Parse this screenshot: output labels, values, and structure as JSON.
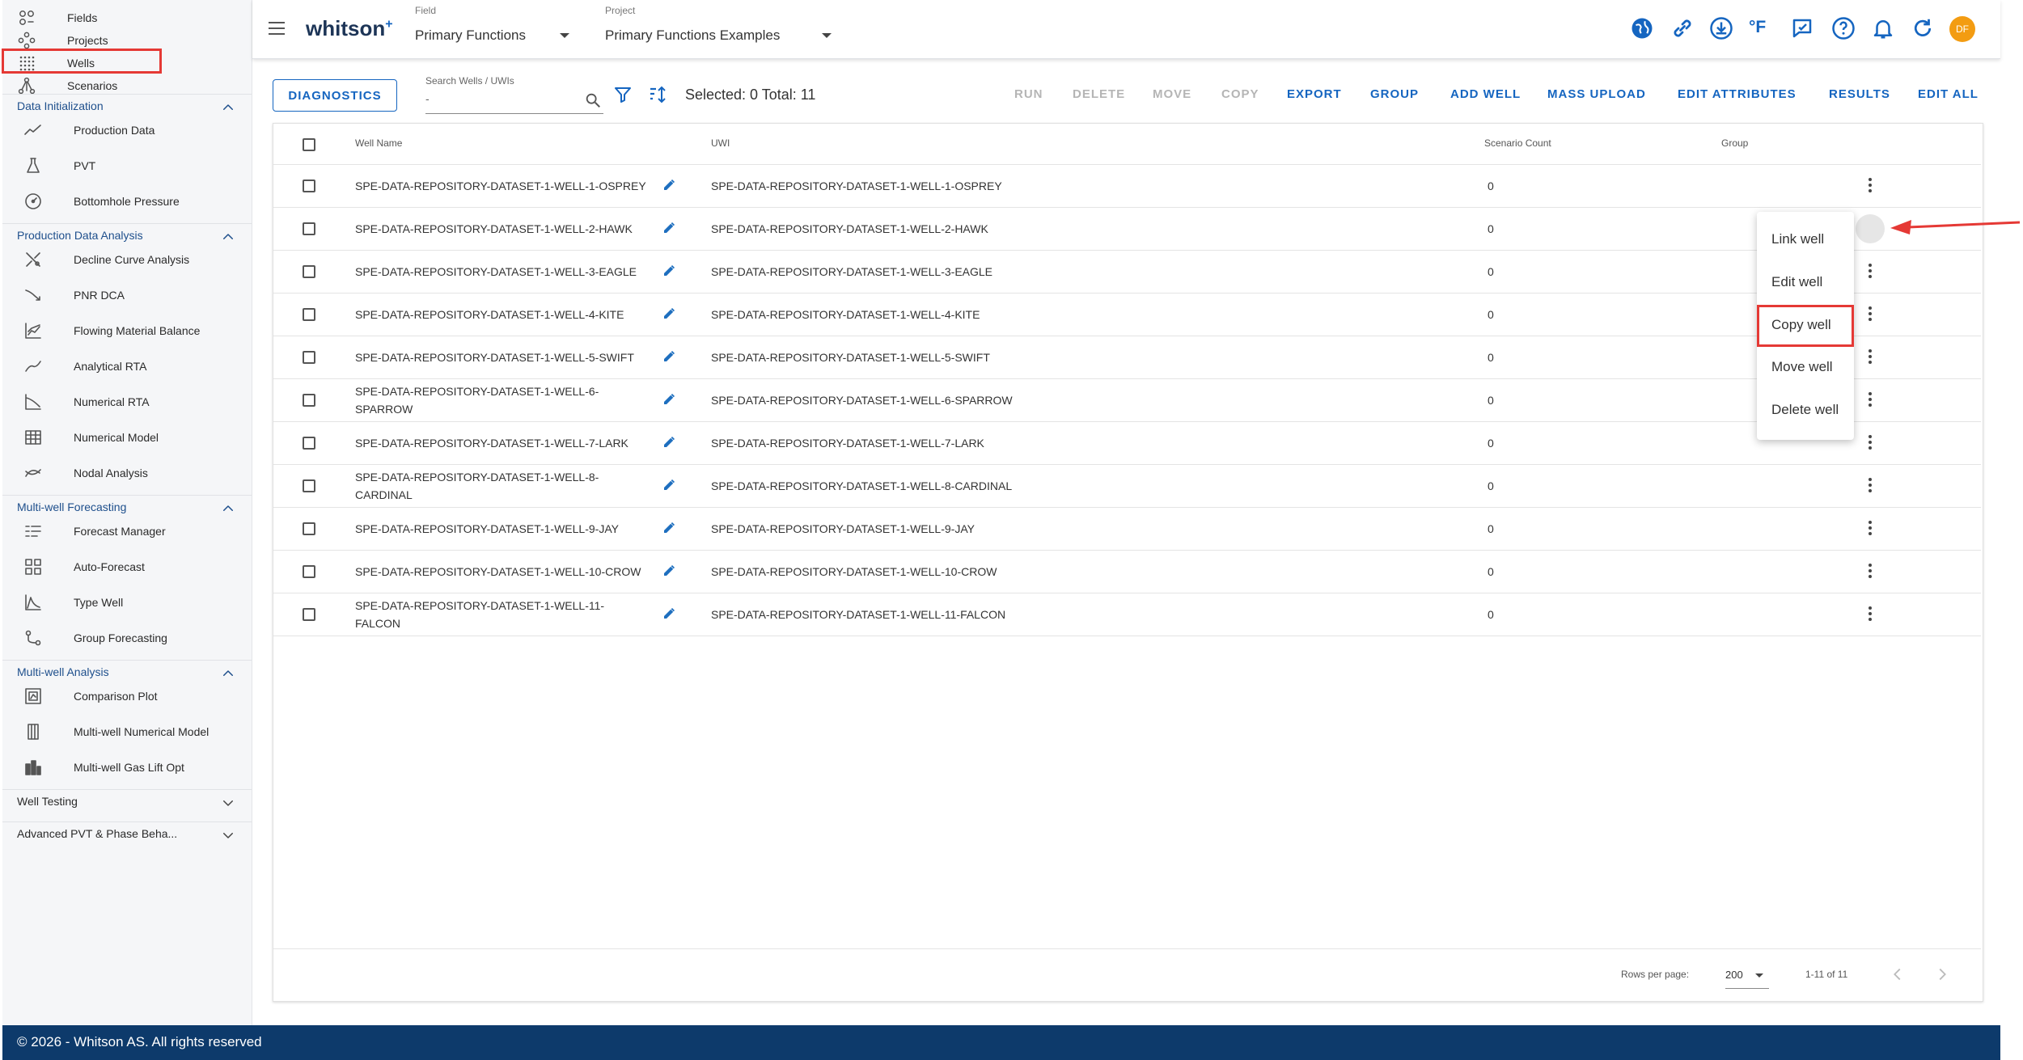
{
  "sidebar": {
    "top_items": [
      {
        "label": "Fields",
        "icon": "fields-icon"
      },
      {
        "label": "Projects",
        "icon": "projects-icon"
      },
      {
        "label": "Wells",
        "icon": "wells-icon",
        "active": true
      },
      {
        "label": "Scenarios",
        "icon": "scenarios-icon"
      }
    ],
    "sections": [
      {
        "title": "Data Initialization",
        "expanded": true,
        "items": [
          "Production Data",
          "PVT",
          "Bottomhole Pressure"
        ]
      },
      {
        "title": "Production Data Analysis",
        "expanded": true,
        "items": [
          "Decline Curve Analysis",
          "PNR DCA",
          "Flowing Material Balance",
          "Analytical RTA",
          "Numerical RTA",
          "Numerical Model",
          "Nodal Analysis"
        ]
      },
      {
        "title": "Multi-well Forecasting",
        "expanded": true,
        "items": [
          "Forecast Manager",
          "Auto-Forecast",
          "Type Well",
          "Group Forecasting"
        ]
      },
      {
        "title": "Multi-well Analysis",
        "expanded": true,
        "items": [
          "Comparison Plot",
          "Multi-well Numerical Model",
          "Multi-well Gas Lift Opt"
        ]
      },
      {
        "title": "Well Testing",
        "expanded": false,
        "items": []
      },
      {
        "title": "Advanced PVT & Phase Beha...",
        "expanded": false,
        "items": []
      }
    ]
  },
  "topbar": {
    "logo": "whitson",
    "logo_sup": "+",
    "field_label": "Field",
    "field_value": "Primary Functions",
    "project_label": "Project",
    "project_value": "Primary Functions Examples",
    "units_label": "°F",
    "avatar_initials": "DF",
    "accent": "#1565c0",
    "avatar_color": "#f39c12"
  },
  "toolbar": {
    "diagnostics": "DIAGNOSTICS",
    "search_label": "Search Wells / UWIs",
    "search_value": "-",
    "selected_text": "Selected: 0 Total: 11",
    "actions": [
      {
        "label": "RUN",
        "enabled": false
      },
      {
        "label": "DELETE",
        "enabled": false
      },
      {
        "label": "MOVE",
        "enabled": false
      },
      {
        "label": "COPY",
        "enabled": false
      },
      {
        "label": "EXPORT",
        "enabled": true
      },
      {
        "label": "GROUP",
        "enabled": true
      },
      {
        "label": "ADD WELL",
        "enabled": true
      },
      {
        "label": "MASS UPLOAD",
        "enabled": true
      },
      {
        "label": "EDIT ATTRIBUTES",
        "enabled": true
      },
      {
        "label": "RESULTS",
        "enabled": true
      },
      {
        "label": "EDIT ALL",
        "enabled": true
      }
    ]
  },
  "table": {
    "headers": {
      "well_name": "Well Name",
      "uwi": "UWI",
      "scenario_count": "Scenario Count",
      "group": "Group"
    },
    "rows": [
      {
        "name": [
          "SPE-DATA-REPOSITORY-DATASET-1-WELL-1-OSPREY"
        ],
        "uwi": "SPE-DATA-REPOSITORY-DATASET-1-WELL-1-OSPREY",
        "count": "0",
        "group": ""
      },
      {
        "name": [
          "SPE-DATA-REPOSITORY-DATASET-1-WELL-2-HAWK"
        ],
        "uwi": "SPE-DATA-REPOSITORY-DATASET-1-WELL-2-HAWK",
        "count": "0",
        "group": ""
      },
      {
        "name": [
          "SPE-DATA-REPOSITORY-DATASET-1-WELL-3-EAGLE"
        ],
        "uwi": "SPE-DATA-REPOSITORY-DATASET-1-WELL-3-EAGLE",
        "count": "0",
        "group": ""
      },
      {
        "name": [
          "SPE-DATA-REPOSITORY-DATASET-1-WELL-4-KITE"
        ],
        "uwi": "SPE-DATA-REPOSITORY-DATASET-1-WELL-4-KITE",
        "count": "0",
        "group": ""
      },
      {
        "name": [
          "SPE-DATA-REPOSITORY-DATASET-1-WELL-5-SWIFT"
        ],
        "uwi": "SPE-DATA-REPOSITORY-DATASET-1-WELL-5-SWIFT",
        "count": "0",
        "group": ""
      },
      {
        "name": [
          "SPE-DATA-REPOSITORY-DATASET-1-WELL-6-",
          "SPARROW"
        ],
        "uwi": "SPE-DATA-REPOSITORY-DATASET-1-WELL-6-SPARROW",
        "count": "0",
        "group": ""
      },
      {
        "name": [
          "SPE-DATA-REPOSITORY-DATASET-1-WELL-7-LARK"
        ],
        "uwi": "SPE-DATA-REPOSITORY-DATASET-1-WELL-7-LARK",
        "count": "0",
        "group": ""
      },
      {
        "name": [
          "SPE-DATA-REPOSITORY-DATASET-1-WELL-8-",
          "CARDINAL"
        ],
        "uwi": "SPE-DATA-REPOSITORY-DATASET-1-WELL-8-CARDINAL",
        "count": "0",
        "group": ""
      },
      {
        "name": [
          "SPE-DATA-REPOSITORY-DATASET-1-WELL-9-JAY"
        ],
        "uwi": "SPE-DATA-REPOSITORY-DATASET-1-WELL-9-JAY",
        "count": "0",
        "group": ""
      },
      {
        "name": [
          "SPE-DATA-REPOSITORY-DATASET-1-WELL-10-CROW"
        ],
        "uwi": "SPE-DATA-REPOSITORY-DATASET-1-WELL-10-CROW",
        "count": "0",
        "group": ""
      },
      {
        "name": [
          "SPE-DATA-REPOSITORY-DATASET-1-WELL-11-",
          "FALCON"
        ],
        "uwi": "SPE-DATA-REPOSITORY-DATASET-1-WELL-11-FALCON",
        "count": "0",
        "group": ""
      }
    ]
  },
  "row_menu": {
    "items": [
      "Link well",
      "Edit well",
      "Copy well",
      "Move well",
      "Delete well"
    ],
    "highlighted": "Copy well"
  },
  "pagination": {
    "rows_per_page_label": "Rows per page:",
    "rows_per_page": "200",
    "range": "1-11 of 11"
  },
  "footer": {
    "text": "© 2026 - Whitson AS. All rights reserved"
  },
  "annotation_color": "#e53935"
}
